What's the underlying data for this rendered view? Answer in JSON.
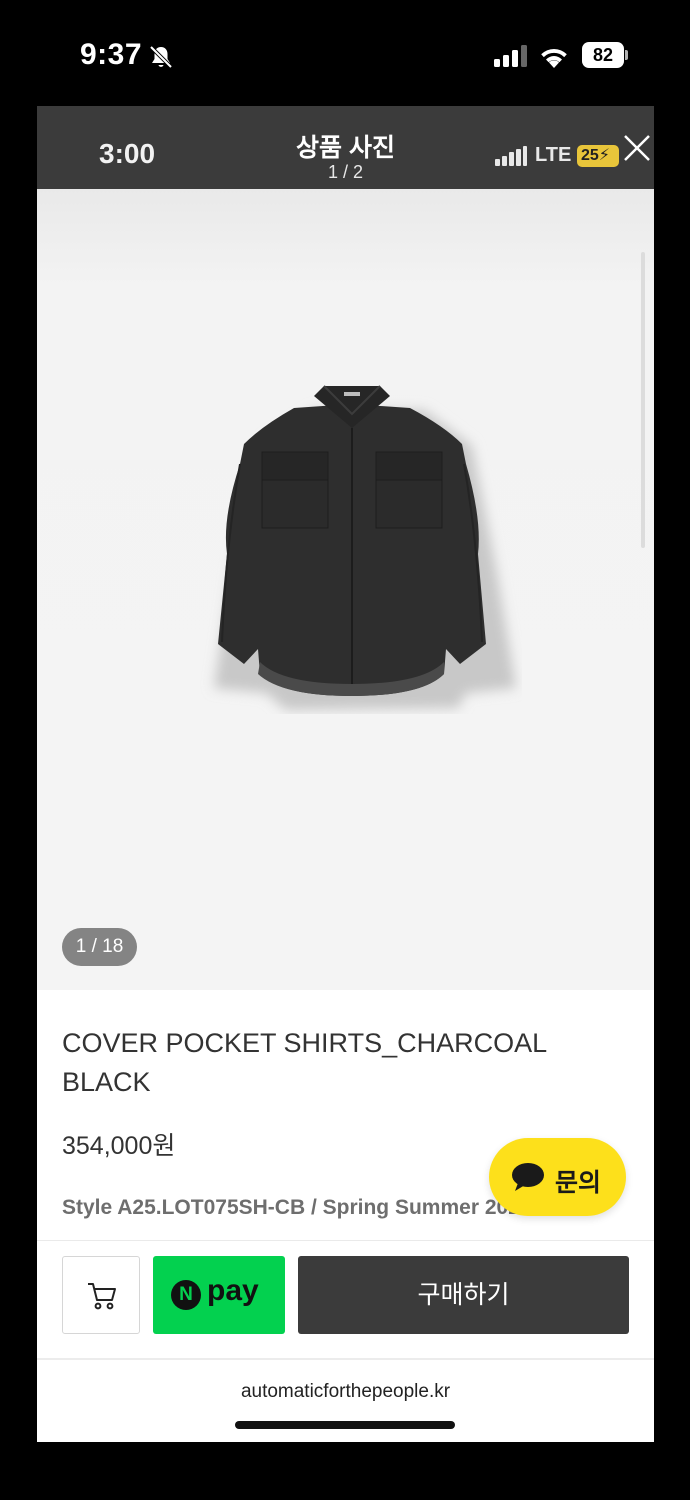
{
  "ios_status": {
    "time": "9:37",
    "battery": "82",
    "icons": [
      "bell-slash-icon",
      "cellular-signal-icon",
      "wifi-icon",
      "battery-icon"
    ]
  },
  "viewer": {
    "inner_time": "3:00",
    "title": "상품 사진",
    "counter": "1 / 2",
    "network": "LTE",
    "inner_battery": "25"
  },
  "photo": {
    "page_indicator": "1 / 18",
    "description_icon": "shirt-photo"
  },
  "product": {
    "name": "COVER POCKET SHIRTS_CHARCOAL BLACK",
    "price": "354,000원",
    "style": "Style A25.LOT075SH-CB / Spring Summer 2025"
  },
  "inquiry": {
    "label": "문의"
  },
  "actions": {
    "npay_n": "N",
    "npay_label": "pay",
    "buy_label": "구매하기"
  },
  "footer": {
    "domain": "automaticforthepeople.kr"
  },
  "colors": {
    "kakao_yellow": "#fde01b",
    "npay_green": "#03d14f",
    "dark_bar": "#3b3b3b"
  }
}
